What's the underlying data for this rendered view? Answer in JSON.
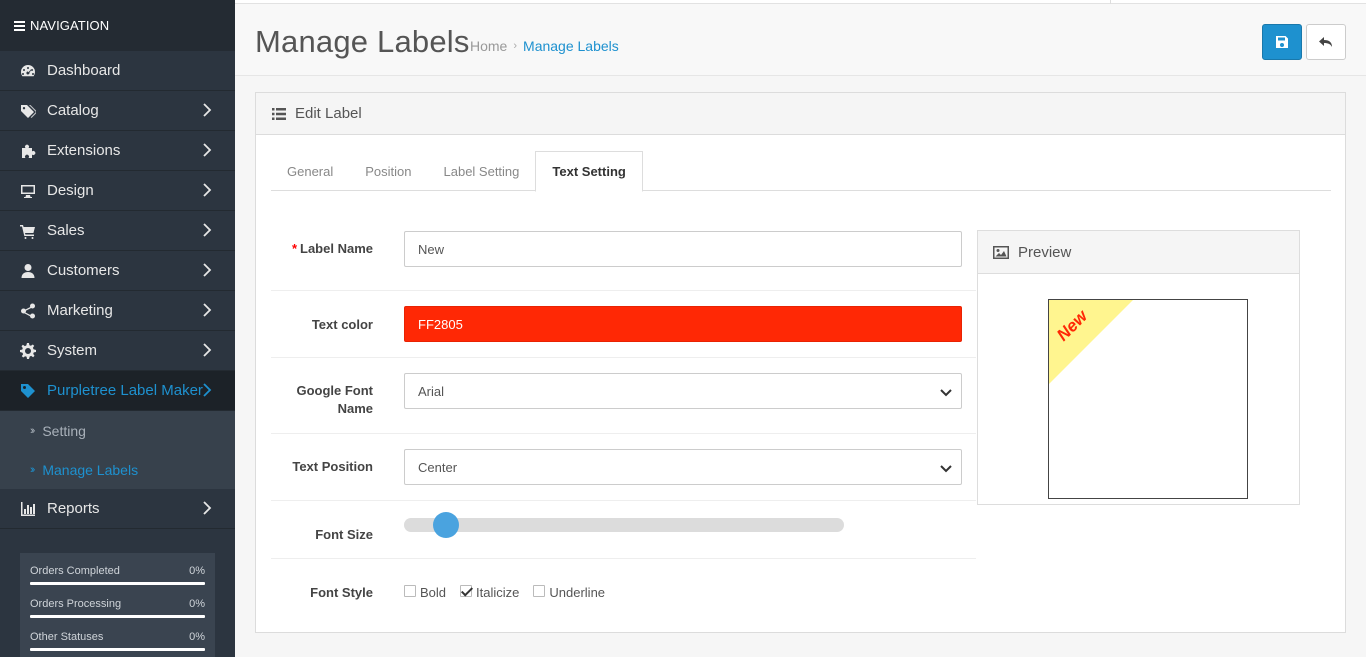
{
  "nav": {
    "title": "NAVIGATION",
    "items": [
      {
        "label": "Dashboard",
        "icon": "dashboard-icon",
        "chevron": false
      },
      {
        "label": "Catalog",
        "icon": "tags-icon",
        "chevron": true
      },
      {
        "label": "Extensions",
        "icon": "puzzle-icon",
        "chevron": true
      },
      {
        "label": "Design",
        "icon": "desktop-icon",
        "chevron": true
      },
      {
        "label": "Sales",
        "icon": "cart-icon",
        "chevron": true
      },
      {
        "label": "Customers",
        "icon": "user-icon",
        "chevron": true
      },
      {
        "label": "Marketing",
        "icon": "share-icon",
        "chevron": true
      },
      {
        "label": "System",
        "icon": "gear-icon",
        "chevron": true
      },
      {
        "label": "Purpletree Label Maker",
        "icon": "tag-icon",
        "chevron": true,
        "active": true
      }
    ],
    "sub_items": [
      {
        "label": "Setting"
      },
      {
        "label": "Manage Labels",
        "active": true
      }
    ],
    "reports": {
      "label": "Reports",
      "icon": "bar-chart-icon"
    },
    "stats": [
      {
        "label": "Orders Completed",
        "value": "0%"
      },
      {
        "label": "Orders Processing",
        "value": "0%"
      },
      {
        "label": "Other Statuses",
        "value": "0%"
      }
    ]
  },
  "header": {
    "title": "Manage Labels",
    "breadcrumb": [
      "Home",
      "Manage Labels"
    ]
  },
  "panel": {
    "title": "Edit Label",
    "tabs": [
      "General",
      "Position",
      "Label Setting",
      "Text Setting"
    ],
    "active_tab": "Text Setting"
  },
  "form": {
    "label_name": {
      "label": "Label Name",
      "required": "*",
      "value": "New"
    },
    "text_color": {
      "label": "Text color",
      "value": "FF2805",
      "color": "#ff2805"
    },
    "google_font": {
      "label": "Google Font Name",
      "value": "Arial"
    },
    "text_position": {
      "label": "Text Position",
      "value": "Center"
    },
    "font_size": {
      "label": "Font Size",
      "slider_fraction": 0.07
    },
    "font_style": {
      "label": "Font Style",
      "options": [
        {
          "label": "Bold",
          "checked": false
        },
        {
          "label": "Italicize",
          "checked": true
        },
        {
          "label": "Underline",
          "checked": false
        }
      ]
    }
  },
  "preview": {
    "title": "Preview",
    "label_text": "New",
    "ribbon_color": "#fff58f",
    "text_color": "#ff2805"
  },
  "colors": {
    "accent": "#1e91cf",
    "sidebar": "#2c3540"
  }
}
